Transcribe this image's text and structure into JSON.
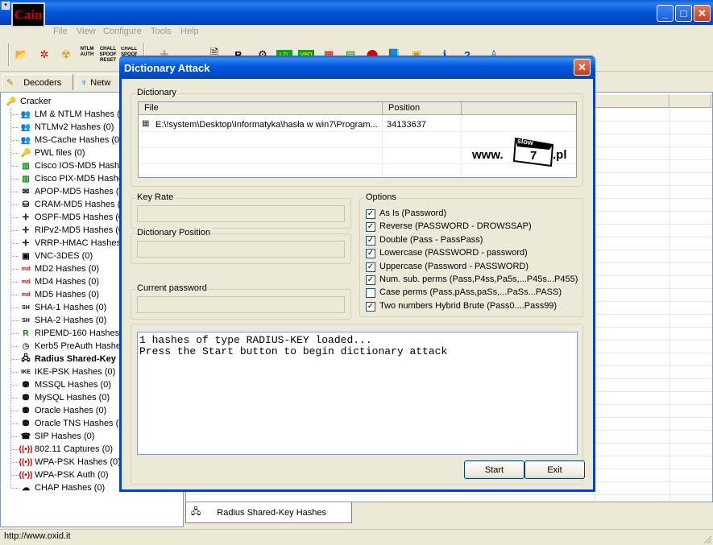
{
  "window": {
    "title_logo": "Cain"
  },
  "menubar": {
    "items": [
      "File",
      "View",
      "Configure",
      "Tools",
      "Help"
    ]
  },
  "toolbar": {
    "ntlm_auth": "NTLM AUTH",
    "chall_spoof_reset": "CHALL SPOOF RESET",
    "chall_spoof": "CHALL SPOOF"
  },
  "tabs": {
    "decoders": "Decoders",
    "network": "Netw"
  },
  "tree": {
    "root": "Cracker",
    "items": [
      {
        "label": "LM & NTLM Hashes (0",
        "icon": "users-icon"
      },
      {
        "label": "NTLMv2 Hashes (0)",
        "icon": "users-icon"
      },
      {
        "label": "MS-Cache Hashes (0",
        "icon": "users-icon"
      },
      {
        "label": "PWL files (0)",
        "icon": "pwl-icon"
      },
      {
        "label": "Cisco IOS-MD5 Hashe",
        "icon": "cisco-icon"
      },
      {
        "label": "Cisco PIX-MD5 Hashe",
        "icon": "cisco-icon"
      },
      {
        "label": "APOP-MD5 Hashes (0",
        "icon": "mail-icon"
      },
      {
        "label": "CRAM-MD5 Hashes (0",
        "icon": "cram-icon"
      },
      {
        "label": "OSPF-MD5 Hashes (0",
        "icon": "router-icon"
      },
      {
        "label": "RIPv2-MD5 Hashes (0",
        "icon": "router-icon"
      },
      {
        "label": "VRRP-HMAC Hashes",
        "icon": "router-icon"
      },
      {
        "label": "VNC-3DES (0)",
        "icon": "vnc-icon"
      },
      {
        "label": "MD2 Hashes (0)",
        "icon": "md2-icon"
      },
      {
        "label": "MD4 Hashes (0)",
        "icon": "md4-icon"
      },
      {
        "label": "MD5 Hashes (0)",
        "icon": "md5-icon"
      },
      {
        "label": "SHA-1 Hashes (0)",
        "icon": "sha1-icon"
      },
      {
        "label": "SHA-2 Hashes (0)",
        "icon": "sha2-icon"
      },
      {
        "label": "RIPEMD-160 Hashes",
        "icon": "ripemd-icon"
      },
      {
        "label": "Kerb5 PreAuth Hashe",
        "icon": "clock-icon"
      },
      {
        "label": "Radius Shared-Key",
        "icon": "radius-icon",
        "bold": true
      },
      {
        "label": "IKE-PSK Hashes (0)",
        "icon": "ike-icon"
      },
      {
        "label": "MSSQL Hashes (0)",
        "icon": "database-icon"
      },
      {
        "label": "MySQL Hashes (0)",
        "icon": "database-icon"
      },
      {
        "label": "Oracle Hashes (0)",
        "icon": "database-icon"
      },
      {
        "label": "Oracle TNS Hashes (0",
        "icon": "database-icon"
      },
      {
        "label": "SIP Hashes (0)",
        "icon": "sip-icon"
      },
      {
        "label": "802.11 Captures (0)",
        "icon": "wifi-icon"
      },
      {
        "label": "WPA-PSK Hashes (0)",
        "icon": "wifi-icon"
      },
      {
        "label": "WPA-PSK Auth (0)",
        "icon": "wifi-icon"
      },
      {
        "label": "CHAP Hashes (0)",
        "icon": "chap-icon"
      }
    ]
  },
  "bottom_tab": {
    "label": "Radius Shared-Key Hashes"
  },
  "status": {
    "text": "http://www.oxid.it"
  },
  "dialog": {
    "title": "Dictionary Attack",
    "dictionary_group": "Dictionary",
    "columns": {
      "file": "File",
      "position": "Position"
    },
    "row": {
      "file": "E:\\!system\\Desktop\\Informatyka\\hasła w win7\\Program...",
      "position": "34133637"
    },
    "watermark": {
      "prefix": "www.",
      "word": "slow",
      "number": "7",
      "suffix": ".pl"
    },
    "key_rate_label": "Key Rate",
    "dictionary_position_label": "Dictionary Position",
    "current_password_label": "Current password",
    "options_label": "Options",
    "options": [
      {
        "label": "As Is (Password)",
        "checked": true
      },
      {
        "label": "Reverse (PASSWORD - DROWSSAP)",
        "checked": true
      },
      {
        "label": "Double (Pass - PassPass)",
        "checked": true
      },
      {
        "label": "Lowercase (PASSWORD - password)",
        "checked": true
      },
      {
        "label": "Uppercase (Password - PASSWORD)",
        "checked": true
      },
      {
        "label": "Num. sub. perms (Pass,P4ss,Pa5s,...P45s...P455)",
        "checked": true
      },
      {
        "label": "Case perms (Pass,pAss,paSs,...PaSs...PASS)",
        "checked": false
      },
      {
        "label": "Two numbers Hybrid Brute (Pass0....Pass99)",
        "checked": true
      }
    ],
    "console_text": "1 hashes of type RADIUS-KEY loaded...\nPress the Start button to begin dictionary attack",
    "start_label": "Start",
    "exit_label": "Exit"
  },
  "colors": {
    "titlebar": "#0054e3",
    "face": "#ece9d8",
    "close": "#d5502a"
  }
}
